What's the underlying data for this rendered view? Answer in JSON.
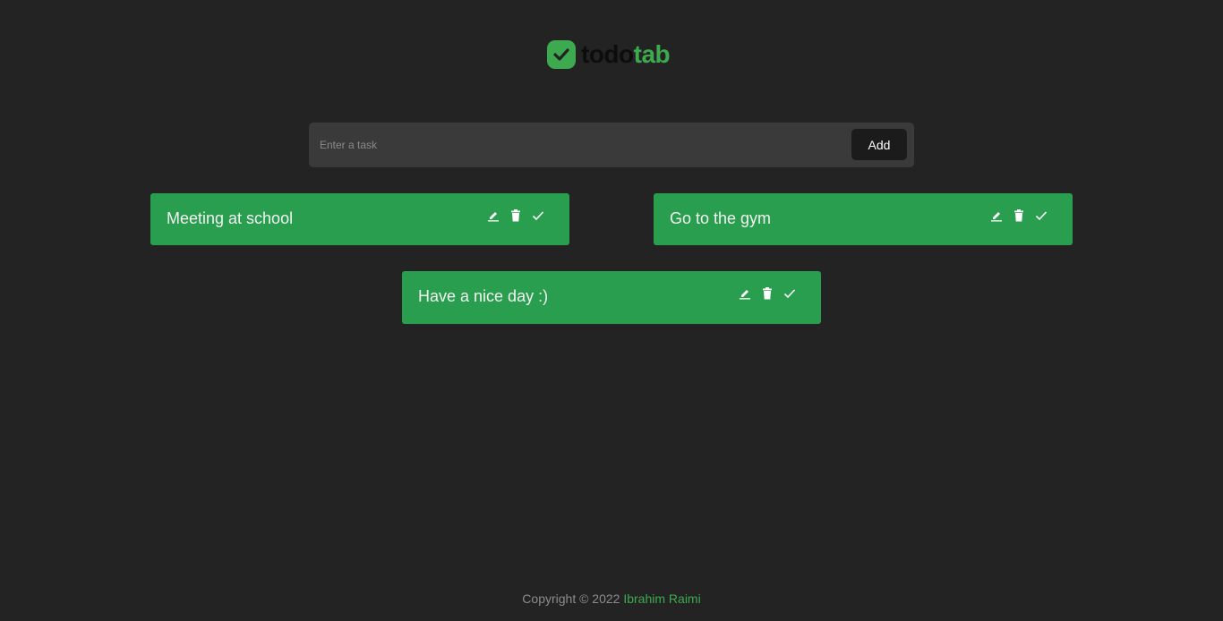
{
  "brand": {
    "name_part1": "todo",
    "name_part2": "tab",
    "logo_icon": "check-badge-icon",
    "accent_color": "#3daa4f"
  },
  "task_form": {
    "placeholder": "Enter a task",
    "value": "",
    "add_label": "Add"
  },
  "tasks": [
    {
      "text": "Meeting at school",
      "actions": [
        "edit-icon",
        "trash-icon",
        "check-icon"
      ]
    },
    {
      "text": "Go to the gym",
      "actions": [
        "edit-icon",
        "trash-icon",
        "check-icon"
      ]
    },
    {
      "text": "Have a nice day :)",
      "actions": [
        "edit-icon",
        "trash-icon",
        "check-icon"
      ]
    }
  ],
  "footer": {
    "copyright": "Copyright © 2022",
    "author": "Ibrahim Raimi"
  },
  "colors": {
    "background": "#232323",
    "card": "#289e4e",
    "input_bg": "#3a3a3a",
    "button_bg": "#1b1b1b"
  }
}
